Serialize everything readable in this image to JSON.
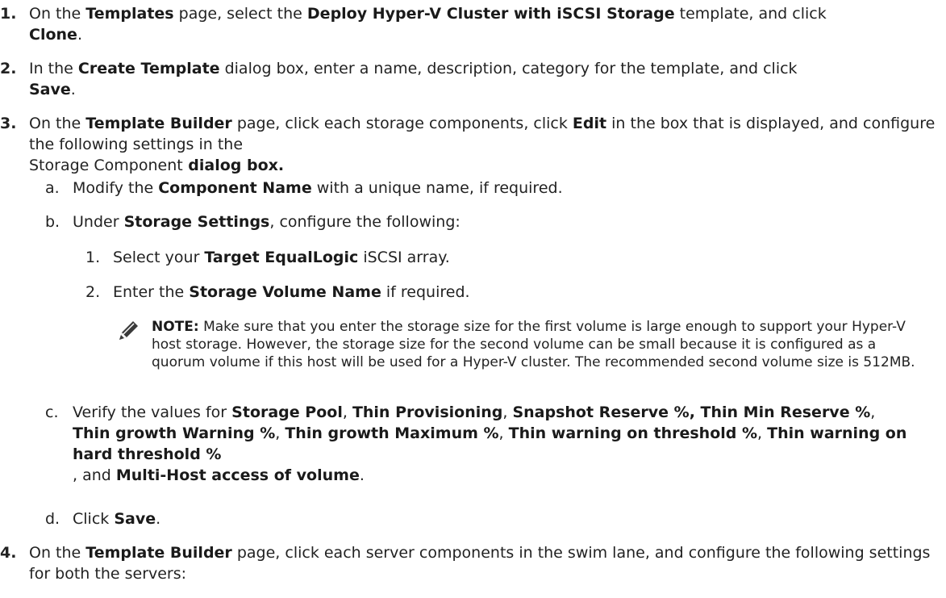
{
  "steps": [
    {
      "num": "1.",
      "parts": [
        "On the ",
        "Templates",
        " page, select the ",
        "Deploy Hyper-V Cluster with iSCSI Storage",
        " template, and click ",
        "Clone",
        "."
      ]
    },
    {
      "num": "2.",
      "parts": [
        "In the ",
        "Create Template",
        " dialog box, enter a name, description, category for the template, and click ",
        "Save",
        "."
      ]
    },
    {
      "num": "3.",
      "parts": [
        "On the ",
        "Template Builder",
        " page, click each storage components, click ",
        "Edit",
        " in the box that is displayed, and configure the following settings in the ",
        "Storage Component",
        " dialog box."
      ]
    },
    {
      "num": "4.",
      "parts": [
        "On the ",
        "Template Builder",
        " page, click each server components in the swim lane, and configure the following settings for both the servers:"
      ]
    }
  ],
  "substeps": [
    {
      "letter": "a.",
      "parts": [
        "Modify the ",
        "Component Name",
        " with a unique name, if required."
      ]
    },
    {
      "letter": "b.",
      "parts": [
        "Under ",
        "Storage Settings",
        ", configure the following:"
      ]
    },
    {
      "letter": "c.",
      "parts": [
        "Verify the values for ",
        "Storage Pool",
        ", ",
        "Thin Provisioning",
        ", ",
        "Snapshot Reserve %, Thin Min Reserve %",
        ", ",
        "Thin growth Warning %",
        ", ",
        "Thin growth Maximum %",
        ", ",
        "Thin warning on threshold %",
        ", ",
        "Thin warning on hard threshold %",
        ", and ",
        "Multi-Host access of volume",
        "."
      ]
    },
    {
      "letter": "d.",
      "parts": [
        "Click ",
        "Save",
        "."
      ]
    }
  ],
  "subsubsteps": [
    {
      "n": "1.",
      "parts": [
        "Select your ",
        "Target EqualLogic",
        " iSCSI array."
      ]
    },
    {
      "n": "2.",
      "parts": [
        "Enter the ",
        "Storage Volume Name",
        " if required."
      ]
    }
  ],
  "note": {
    "label": "NOTE:",
    "text": " Make sure that you enter the storage size for the first volume is large enough to support your Hyper-V host storage. However, the storage size for the second volume can be small because it is configured as a quorum volume if this host will be used for a Hyper-V cluster. The recommended second volume size is 512MB."
  },
  "icons": {
    "note_icon": "pencil-icon"
  }
}
